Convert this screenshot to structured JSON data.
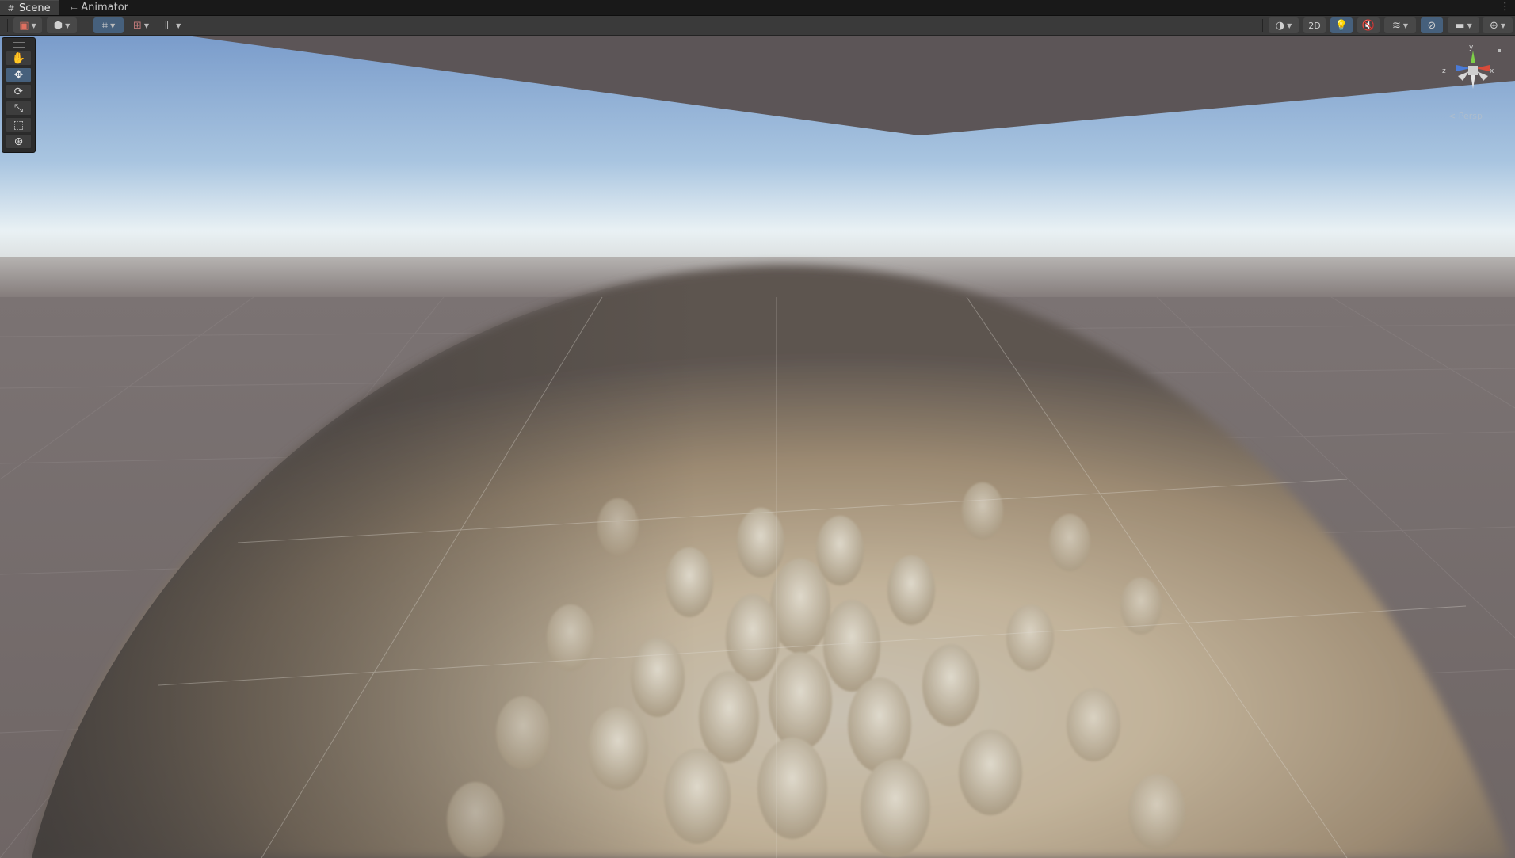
{
  "tabs": [
    {
      "label": "Scene",
      "icon": "grid-icon",
      "active": true
    },
    {
      "label": "Animator",
      "icon": "animator-icon",
      "active": false
    }
  ],
  "toolbar": {
    "view_2d_label": "2D",
    "tools": [
      "draw-mode-icon",
      "shading-cube-icon",
      "grid-snap-icon",
      "increment-snap-icon",
      "ruler-icon"
    ],
    "right_tools": [
      "render-mode-icon",
      "2d-toggle",
      "lighting-icon",
      "audio-icon",
      "effects-icon",
      "hidden-objects-icon",
      "camera-icon",
      "gizmos-icon"
    ]
  },
  "scene_tools": [
    {
      "name": "hand-tool",
      "icon": "hand-icon",
      "active": false
    },
    {
      "name": "move-tool",
      "icon": "move-icon",
      "active": true
    },
    {
      "name": "rotate-tool",
      "icon": "rotate-icon",
      "active": false
    },
    {
      "name": "scale-tool",
      "icon": "scale-icon",
      "active": false
    },
    {
      "name": "rect-tool",
      "icon": "rect-icon",
      "active": false
    },
    {
      "name": "transform-tool",
      "icon": "transform-icon",
      "active": false
    }
  ],
  "gizmo": {
    "axis_y_label": "y",
    "axis_x_label": "x",
    "axis_z_label": "z",
    "projection_label": "Persp"
  },
  "colors": {
    "accent": "#46607c",
    "sky_top": "#7f9fcc",
    "horizon": "#e6eef2",
    "ground": "#736b6a",
    "axis_x": "#d84b3a",
    "axis_y": "#7ed048",
    "axis_z": "#4a7bd8"
  }
}
